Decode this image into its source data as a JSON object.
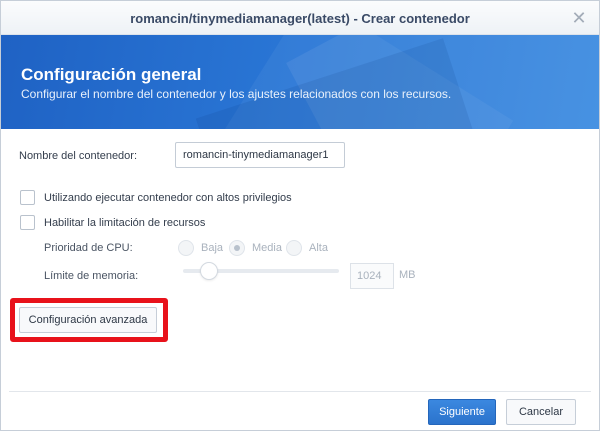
{
  "window": {
    "title": "romancin/tinymediamanager(latest) - Crear contenedor",
    "close_glyph": "✕"
  },
  "banner": {
    "heading": "Configuración general",
    "subheading": "Configurar el nombre del contenedor y los ajustes relacionados con los recursos."
  },
  "form": {
    "container_name_label": "Nombre del contenedor:",
    "container_name_value": "romancin-tinymediamanager1",
    "privileged_label": "Utilizando ejecutar contenedor con altos privilegios",
    "privileged_checked": false,
    "resource_limit_label": "Habilitar la limitación de recursos",
    "resource_limit_checked": false,
    "cpu_priority_label": "Prioridad de CPU:",
    "cpu_options": [
      "Baja",
      "Media",
      "Alta"
    ],
    "cpu_selected": "Media",
    "memory_limit_label": "Límite de memoria:",
    "memory_value": "1024",
    "memory_unit": "MB",
    "memory_slider_fraction": 0.15
  },
  "buttons": {
    "advanced": "Configuración avanzada",
    "next": "Siguiente",
    "cancel": "Cancelar"
  },
  "colors": {
    "banner_blue": "#2a77d6",
    "highlight_red": "#e8121b",
    "primary_button": "#2b73cc"
  },
  "icons": {
    "close": "close-icon"
  }
}
